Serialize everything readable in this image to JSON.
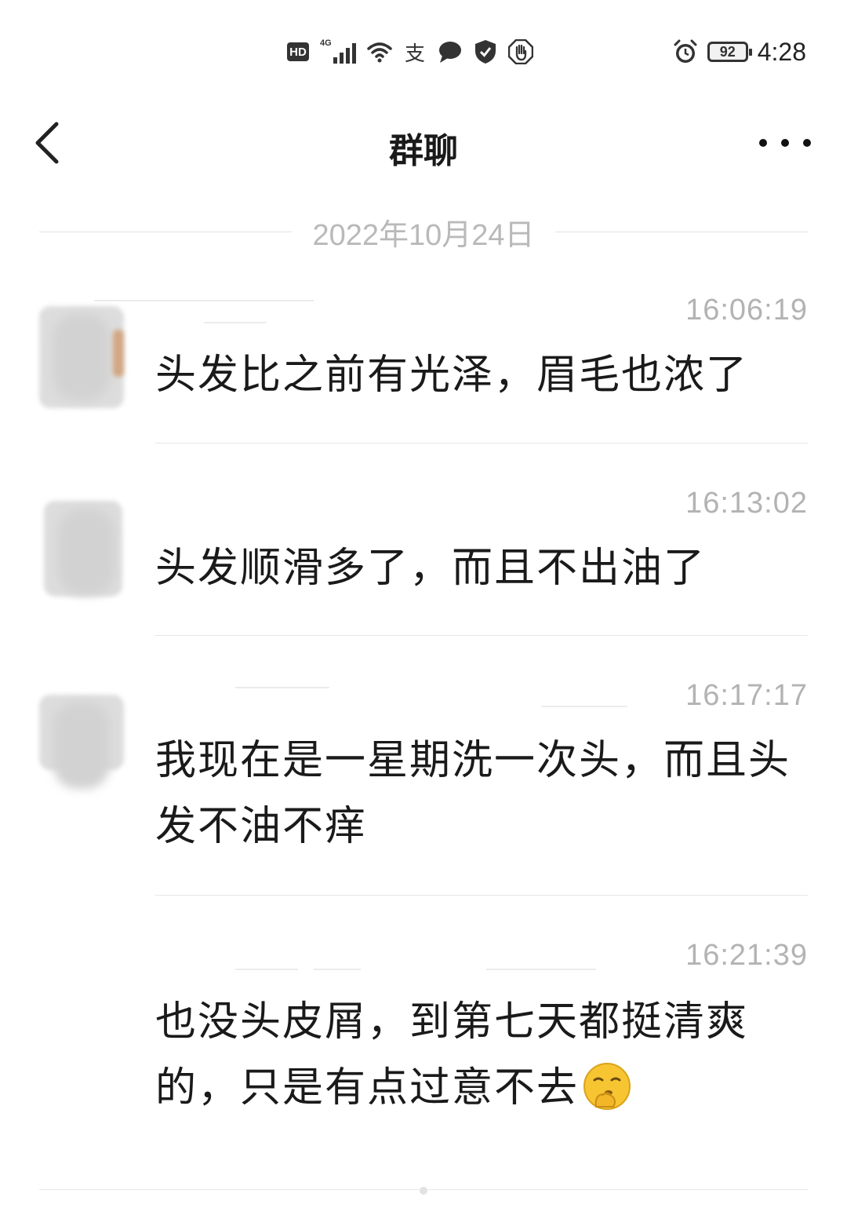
{
  "status_bar": {
    "hd": "HD",
    "network": "4G",
    "pay_glyph": "支",
    "battery": "92",
    "time": "4:28",
    "icons": [
      "hd-icon",
      "signal-icon",
      "wifi-icon",
      "alipay-icon",
      "chat-bubble-icon",
      "shield-icon",
      "hand-stop-icon",
      "alarm-icon",
      "battery-icon"
    ]
  },
  "nav": {
    "title": "群聊",
    "back_icon": "chevron-left-icon",
    "more_icon": "more-dots-icon"
  },
  "date_divider": "2022年10月24日",
  "messages": [
    {
      "time": "16:06:19",
      "text": "头发比之前有光泽，眉毛也浓了"
    },
    {
      "time": "16:13:02",
      "text": "头发顺滑多了，而且不出油了"
    },
    {
      "time": "16:17:17",
      "text": "我现在是一星期洗一次头，而且头发不油不痒"
    },
    {
      "time": "16:21:39",
      "text": "也没头皮屑，到第七天都挺清爽的，只是有点过意不去",
      "emoji": "shushing-face-emoji"
    }
  ]
}
